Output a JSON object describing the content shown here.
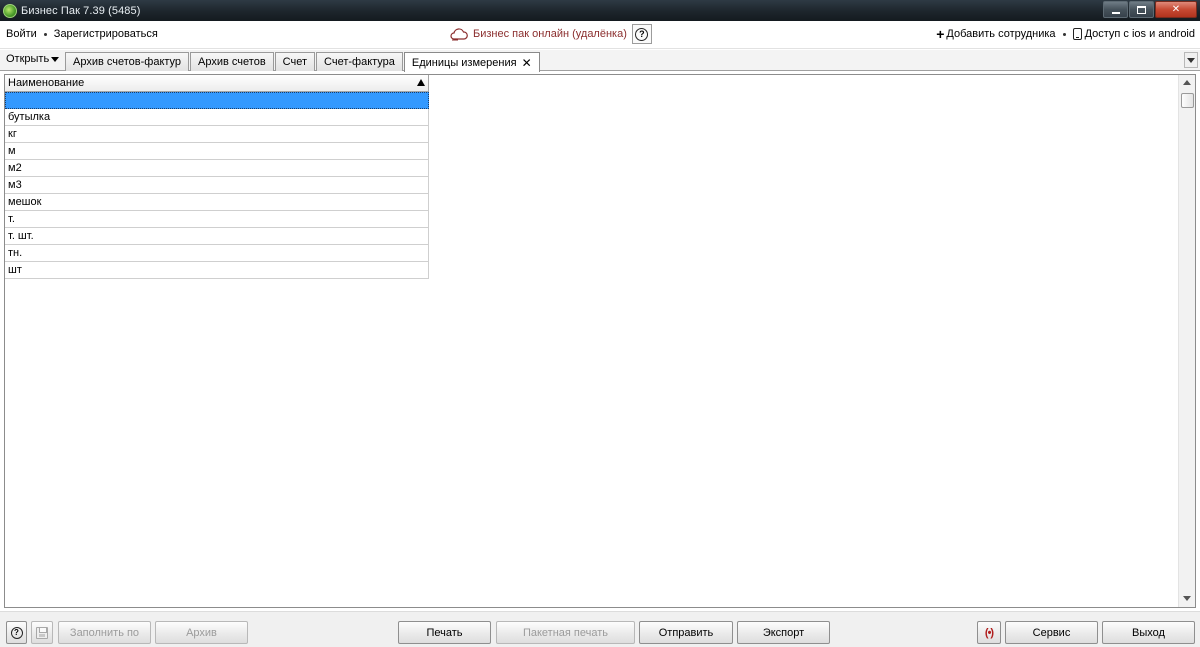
{
  "window": {
    "title": "Бизнес Пак 7.39 (5485)",
    "controls": {
      "minimize": "",
      "maximize": "",
      "close": "✕"
    }
  },
  "topbar": {
    "login": "Войти",
    "register": "Зарегистрироваться",
    "online": "Бизнес пак онлайн (удалёнка)",
    "help": "?",
    "add_employee": "Добавить сотрудника",
    "mobile_access": "Доступ с ios и android"
  },
  "tabs": {
    "open_menu": "Открыть",
    "items": [
      {
        "label": "Архив счетов-фактур"
      },
      {
        "label": "Архив счетов"
      },
      {
        "label": "Счет"
      },
      {
        "label": "Счет-фактура"
      },
      {
        "label": "Единицы измерения"
      }
    ],
    "close_glyph": "✕"
  },
  "grid": {
    "column_header": "Наименование",
    "rows": [
      "",
      "бутылка",
      "кг",
      "м",
      "м2",
      "м3",
      "мешок",
      "т.",
      "т. шт.",
      "тн.",
      "шт"
    ]
  },
  "bottombar": {
    "help": "?",
    "fill_by": "Заполнить по",
    "archive": "Архив",
    "print": "Печать",
    "batch_print": "Пакетная печать",
    "send": "Отправить",
    "export": "Экспорт",
    "broadcast": "(•)",
    "service": "Сервис",
    "exit": "Выход"
  },
  "colors": {
    "selection": "#3399ff",
    "online_link": "#8b2e2e",
    "close_button": "#c74a33",
    "broadcast_icon": "#b01e1e"
  }
}
